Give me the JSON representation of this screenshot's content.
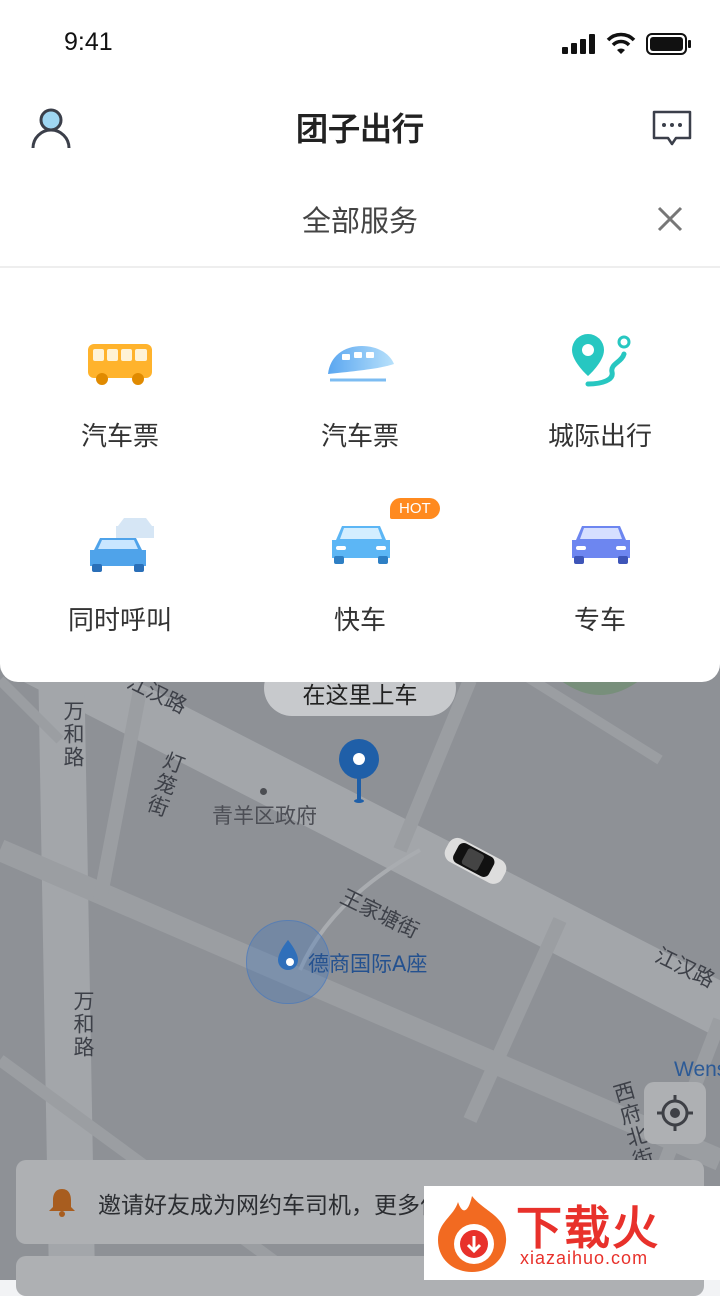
{
  "status_bar": {
    "time": "9:41"
  },
  "header": {
    "title": "团子出行"
  },
  "services": {
    "title": "全部服务",
    "items": [
      {
        "label": "汽车票",
        "icon": "bus-icon"
      },
      {
        "label": "汽车票",
        "icon": "train-icon"
      },
      {
        "label": "城际出行",
        "icon": "route-pin-icon"
      },
      {
        "label": "同时呼叫",
        "icon": "multi-car-icon"
      },
      {
        "label": "快车",
        "icon": "express-car-icon",
        "badge": "HOT"
      },
      {
        "label": "专车",
        "icon": "premium-car-icon"
      }
    ]
  },
  "map": {
    "pickup_tip": "在这里上车",
    "labels": {
      "jianghan_road_top": "江汉路",
      "wanhe_road_top": "万和路",
      "denglong_street": "灯笼街",
      "qingyang_gov": "青羊区政府",
      "current_location": "德商国际A座",
      "wangjiatang_street": "王家塘街",
      "jianghan_road_right": "江汉路",
      "wanhe_road_bottom": "万和路",
      "xifu_north_street": "西府北街",
      "wens": "Wens"
    }
  },
  "banner": {
    "text": "邀请好友成为网约车司机，更多优惠等你拿"
  },
  "watermark": {
    "brand": "下载火",
    "domain": "xiazaihuo.com"
  },
  "colors": {
    "accent_blue": "#2f7fd8",
    "hot_badge": "#ff8a1f",
    "bus_yellow": "#ffb32c",
    "teal": "#27c7c1"
  }
}
